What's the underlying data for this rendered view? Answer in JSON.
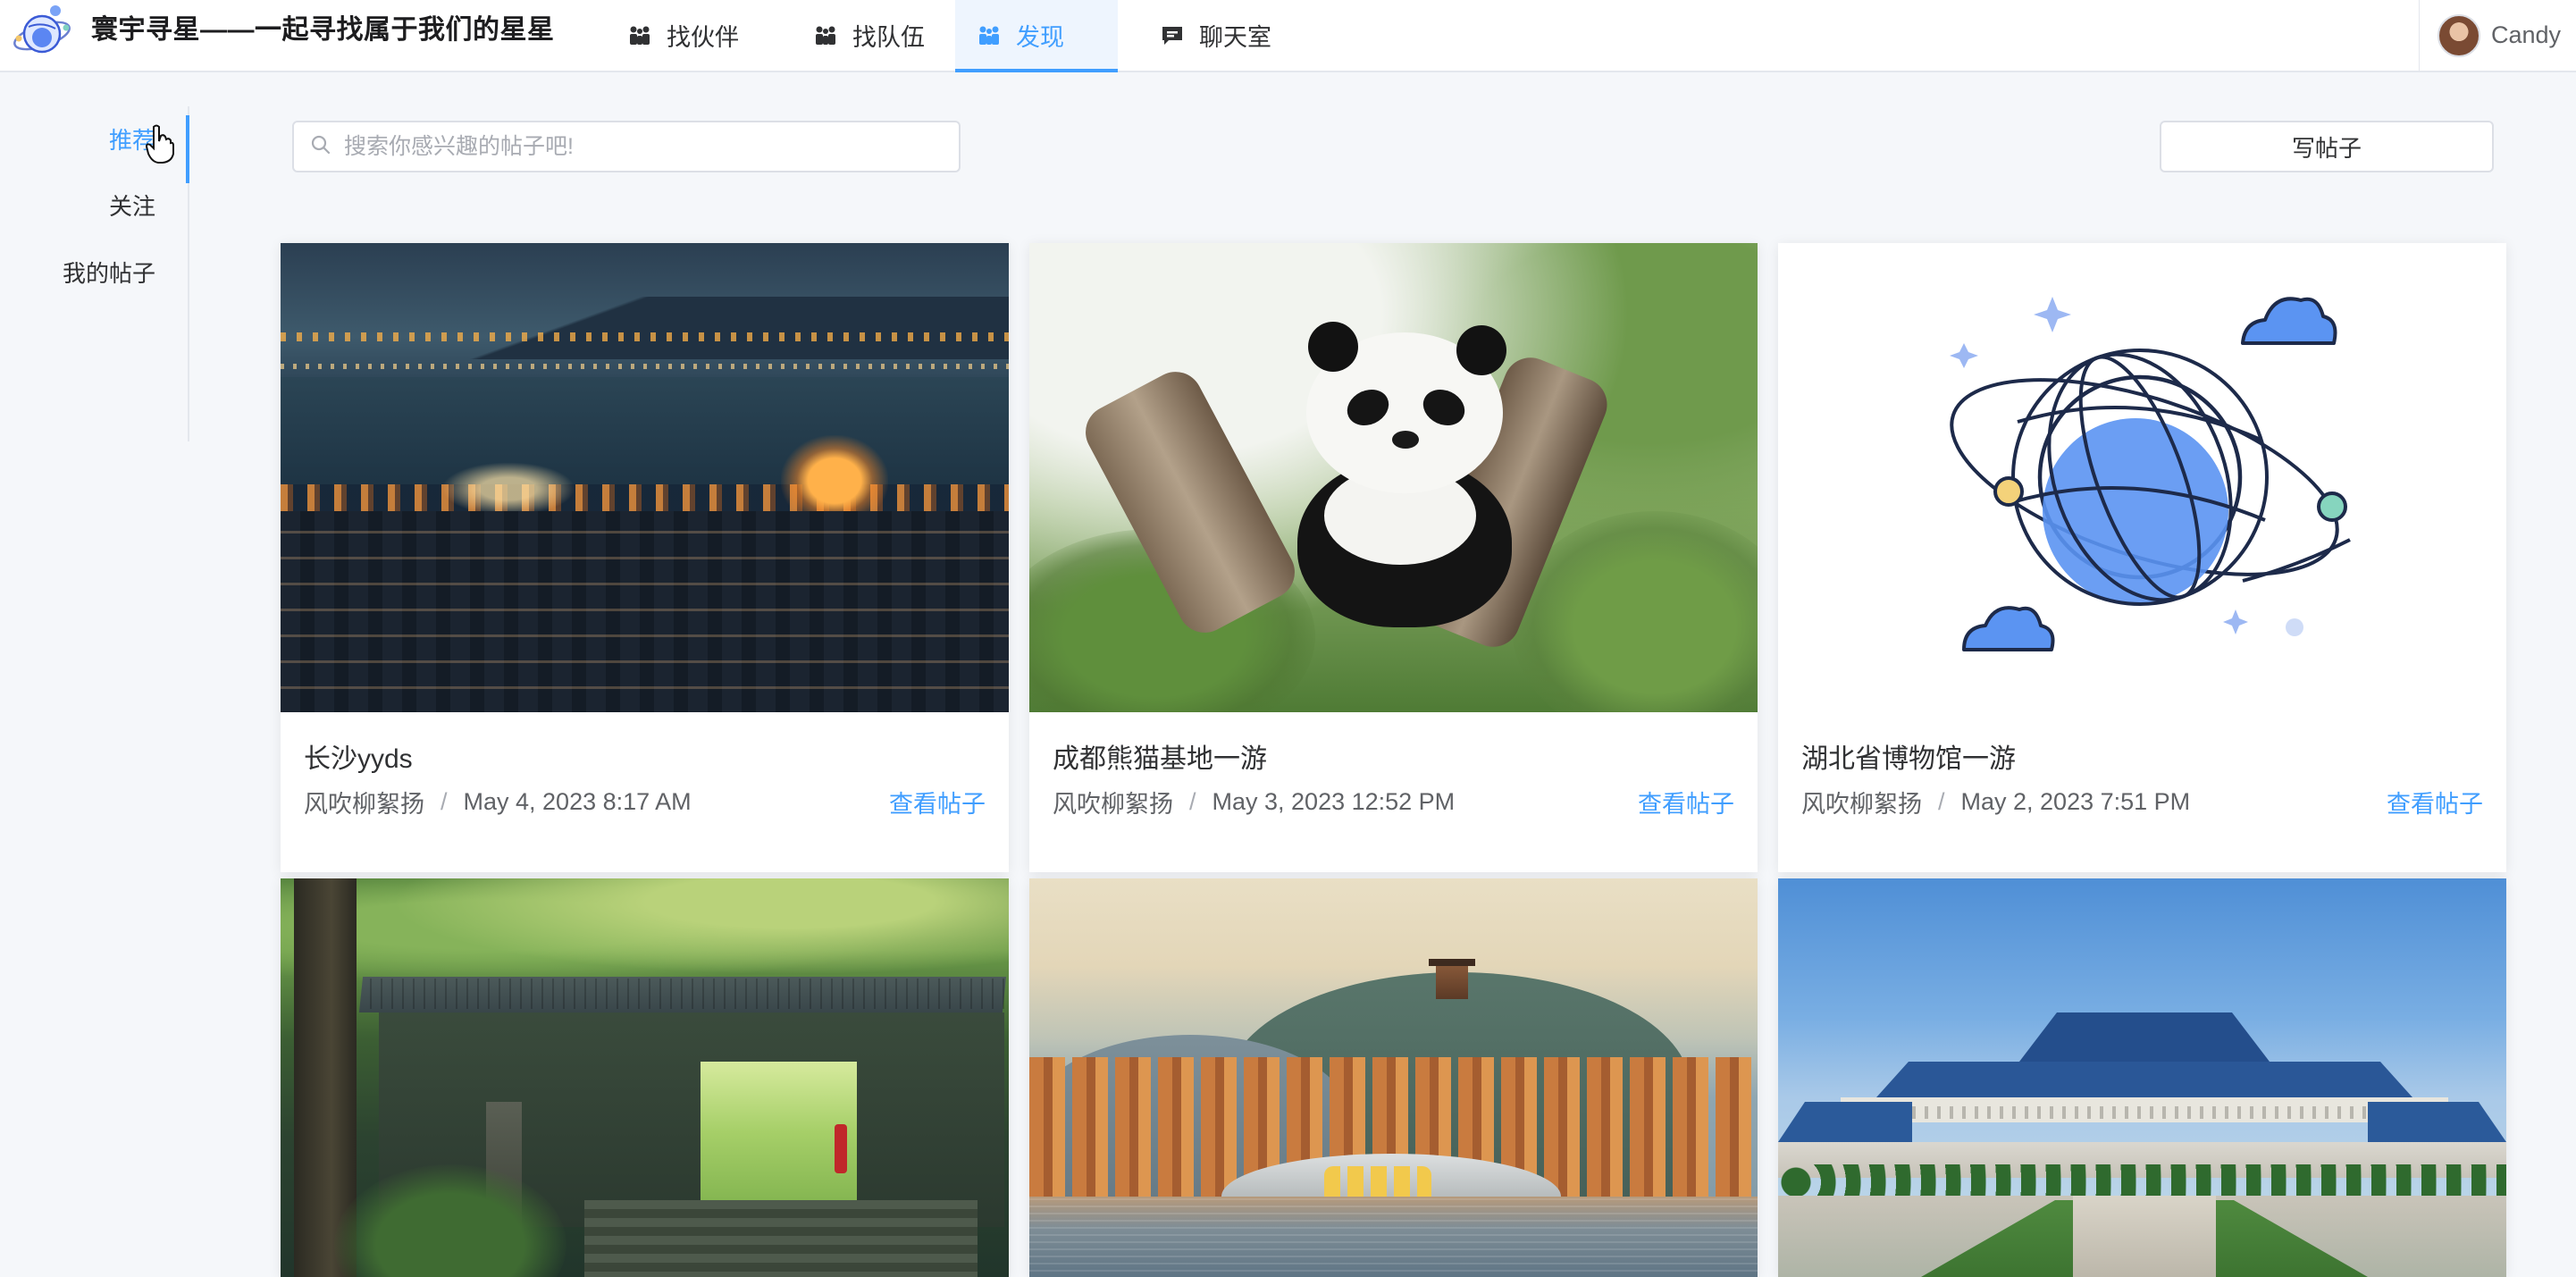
{
  "app": {
    "brand_title": "寰宇寻星——一起寻找属于我们的星星",
    "logo_icon": "planet-logo-icon"
  },
  "nav": {
    "items": [
      {
        "label": "找伙伴",
        "icon": "people-icon"
      },
      {
        "label": "找队伍",
        "icon": "team-icon"
      },
      {
        "label": "发现",
        "icon": "discover-icon",
        "active": true
      },
      {
        "label": "聊天室",
        "icon": "chat-icon"
      }
    ],
    "user": {
      "name": "Candy",
      "avatar": "avatar-icon"
    }
  },
  "sidebar": {
    "items": [
      {
        "label": "推荐",
        "active": true
      },
      {
        "label": "关注"
      },
      {
        "label": "我的帖子"
      }
    ]
  },
  "toolbar": {
    "search_placeholder": "搜索你感兴趣的帖子吧!",
    "search_value": "",
    "write_button": "写帖子"
  },
  "posts": [
    {
      "title": "长沙yyds",
      "author": "风吹柳絮扬",
      "separator": "/",
      "date": "May 4, 2023 8:17 AM",
      "action": "查看帖子",
      "image": "night-city-photo"
    },
    {
      "title": "成都熊猫基地一游",
      "author": "风吹柳絮扬",
      "separator": "/",
      "date": "May 3, 2023 12:52 PM",
      "action": "查看帖子",
      "image": "panda-photo"
    },
    {
      "title": "湖北省博物馆一游",
      "author": "风吹柳絮扬",
      "separator": "/",
      "date": "May 2, 2023 7:51 PM",
      "action": "查看帖子",
      "image": "planet-illustration"
    },
    {
      "image": "anime-temple-photo"
    },
    {
      "image": "lake-bridge-photo"
    },
    {
      "image": "museum-building-photo"
    }
  ],
  "colors": {
    "accent": "#409eff",
    "background": "#f5f7fa",
    "card": "#ffffff",
    "text": "#303133",
    "muted": "#606266"
  }
}
